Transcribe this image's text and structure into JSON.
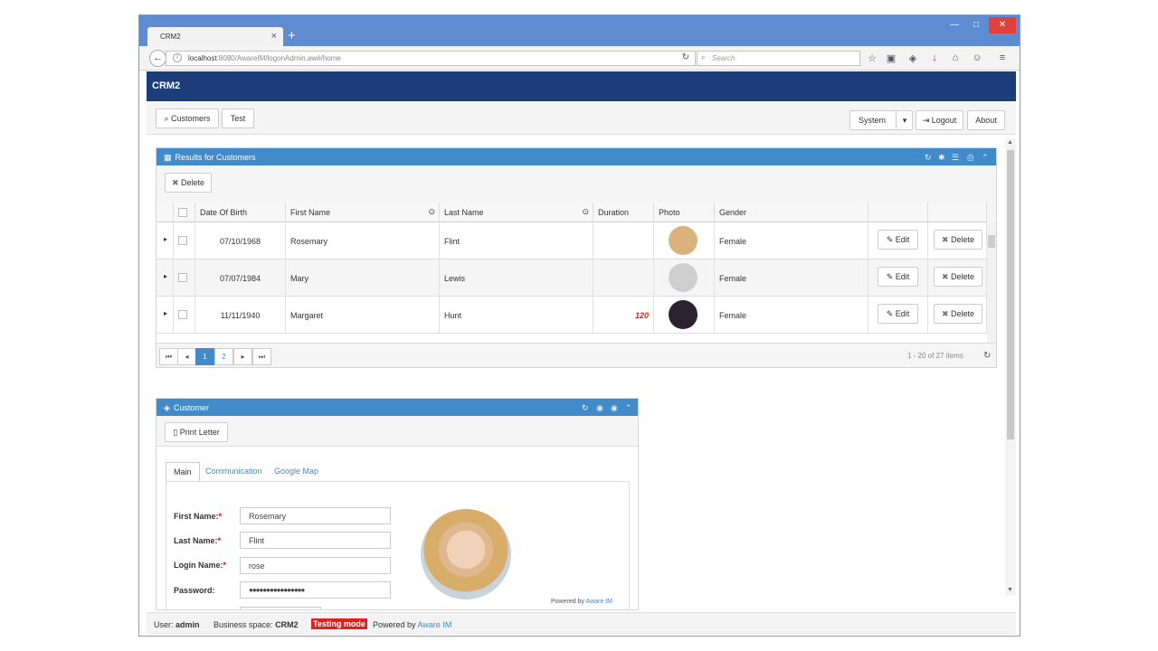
{
  "browser": {
    "tab_title": "CRM2",
    "tab_close": "×",
    "new_tab": "+",
    "url_host": "localhost",
    "url_rest": ":8080/AwareIM/logonAdmin.aw#/home",
    "search_placeholder": "Search"
  },
  "app": {
    "title": "CRM2",
    "toolbar": {
      "customers": "Customers",
      "test": "Test",
      "system": "System",
      "logout": "Logout",
      "about": "About"
    }
  },
  "results": {
    "title": "Results for Customers",
    "delete_label": "Delete",
    "columns": [
      "Date Of Birth",
      "First Name",
      "Last Name",
      "Duration",
      "Photo",
      "Gender"
    ],
    "rows": [
      {
        "dob": "07/10/1968",
        "first": "Rosemary",
        "last": "Flint",
        "duration": "",
        "gender": "Female",
        "photo_color": "#d9b27c"
      },
      {
        "dob": "07/07/1984",
        "first": "Mary",
        "last": "Lewis",
        "duration": "",
        "gender": "Female",
        "photo_color": "#cfcfcf"
      },
      {
        "dob": "11/11/1940",
        "first": "Margaret",
        "last": "Hunt",
        "duration": "120",
        "gender": "Female",
        "photo_color": "#2b2230"
      }
    ],
    "edit_label": "Edit",
    "row_delete_label": "Delete",
    "pager": {
      "pages": [
        "1",
        "2"
      ],
      "current": "1",
      "summary": "1 - 20 of 27 items"
    }
  },
  "customer": {
    "title": "Customer",
    "print_letter": "Print Letter",
    "tabs": [
      "Main",
      "Communication",
      "Google Map"
    ],
    "fields": {
      "first_name_label": "First Name:",
      "first_name": "Rosemary",
      "last_name_label": "Last Name:",
      "last_name": "Flint",
      "login_label": "Login Name:",
      "login": "rose",
      "password_label": "Password:",
      "password": "●●●●●●●●●●●●●●●●"
    },
    "required_mark": "*"
  },
  "powered": {
    "text": "Powered by",
    "link": "Aware IM"
  },
  "statusbar": {
    "user_label": "User:",
    "user": "admin",
    "space_label": "Business space:",
    "space": "CRM2",
    "testing": "Testing mode",
    "powered_label": "Powered by",
    "powered_link": "Aware IM"
  },
  "colors": {
    "header": "#1c3d7a",
    "panel": "#428bca",
    "accent_red": "#e02020"
  }
}
